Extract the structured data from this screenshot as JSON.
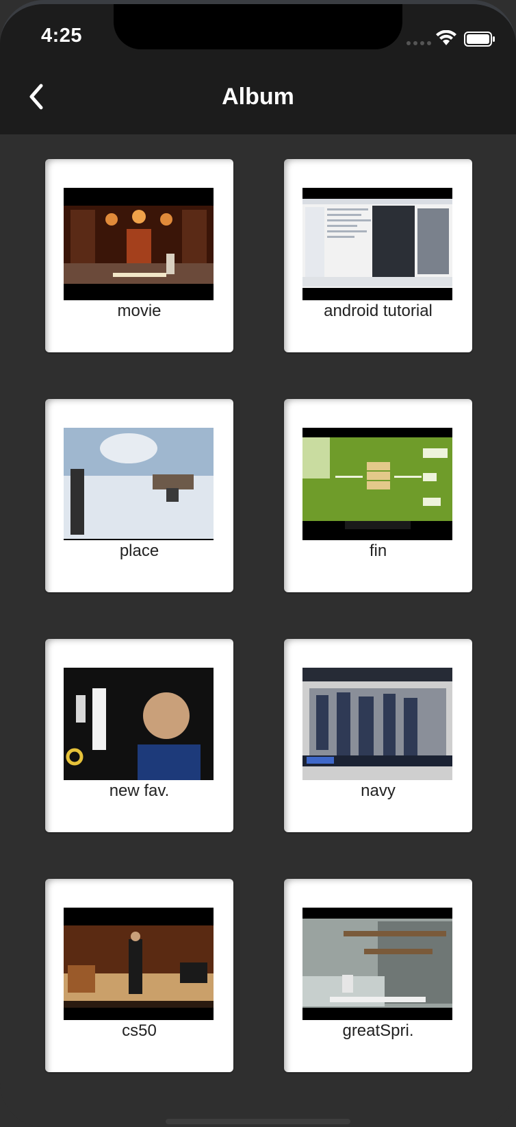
{
  "status": {
    "time": "4:25"
  },
  "nav": {
    "title": "Album",
    "back_icon": "chevron-left-icon"
  },
  "albums": [
    {
      "label": "movie",
      "colors": [
        "#2a0f08",
        "#a4401c",
        "#e08a3a",
        "#5a2a16"
      ]
    },
    {
      "label": "android tutorial",
      "colors": [
        "#f2f2f2",
        "#d9dde3",
        "#2b2f36",
        "#aab2bd"
      ]
    },
    {
      "label": "place",
      "colors": [
        "#9fb7cf",
        "#e7ecf2",
        "#dfe6ee",
        "#3a3a3a"
      ]
    },
    {
      "label": "fin",
      "colors": [
        "#4e7a1c",
        "#8fbd3a",
        "#b9d66a",
        "#2f4a10"
      ]
    },
    {
      "label": "new fav.",
      "colors": [
        "#101010",
        "#2a2a2a",
        "#c9a07a",
        "#1d3a7a"
      ]
    },
    {
      "label": "navy",
      "colors": [
        "#cfcfcf",
        "#2f3a55",
        "#8a8f99",
        "#1b2233"
      ]
    },
    {
      "label": "cs50",
      "colors": [
        "#5a2a12",
        "#9a5a2a",
        "#caa06a",
        "#1a1a1a"
      ]
    },
    {
      "label": "greatSpri.",
      "colors": [
        "#9aa3a0",
        "#c7cfcd",
        "#7a5a3a",
        "#6f7775"
      ]
    }
  ]
}
